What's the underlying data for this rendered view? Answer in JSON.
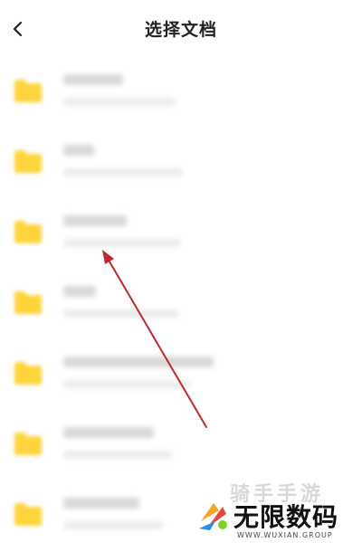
{
  "header": {
    "title": "选择文档",
    "back_icon": "chevron-left-icon"
  },
  "folders": [
    {
      "icon": "folder-icon",
      "color": "#FFD43B"
    },
    {
      "icon": "folder-icon",
      "color": "#FFD43B"
    },
    {
      "icon": "folder-icon",
      "color": "#FFD43B"
    },
    {
      "icon": "folder-icon",
      "color": "#FFD43B"
    },
    {
      "icon": "folder-icon",
      "color": "#FFD43B"
    },
    {
      "icon": "folder-icon",
      "color": "#FFD43B"
    },
    {
      "icon": "folder-icon",
      "color": "#FFD43B"
    }
  ],
  "annotation": {
    "arrow_color": "#C0282D"
  },
  "watermark": {
    "top_text": "骑手手游",
    "main_text": "无限数码",
    "sub_text": "WWW.WUXIAN.GROUP"
  }
}
